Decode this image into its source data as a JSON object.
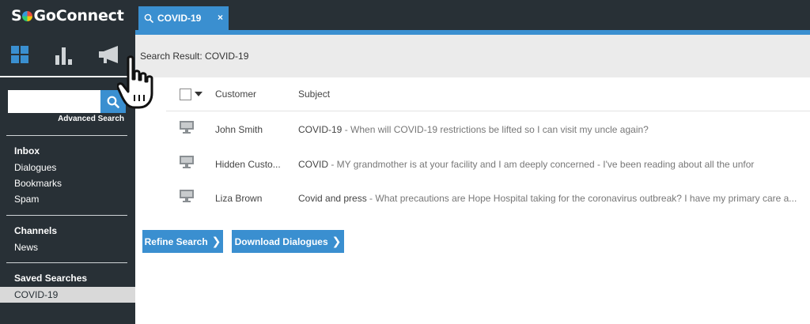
{
  "app": {
    "logo_s": "S",
    "logo_rest": "GoConnect"
  },
  "sidebar": {
    "search_placeholder": "",
    "advanced_search": "Advanced Search",
    "sections": [
      {
        "title": "Inbox",
        "items": [
          "Dialogues",
          "Bookmarks",
          "Spam"
        ]
      },
      {
        "title": "Channels",
        "items": [
          "News"
        ]
      },
      {
        "title": "Saved Searches",
        "items": [
          "COVID-19"
        ]
      }
    ]
  },
  "tab": {
    "label": "COVID-19",
    "close": "×"
  },
  "result": {
    "text": "Search Result: COVID-19"
  },
  "table": {
    "headers": {
      "customer": "Customer",
      "subject": "Subject"
    },
    "rows": [
      {
        "customer": "John Smith",
        "subject": "COVID-19",
        "preview": " - When will COVID-19 restrictions be lifted so I can visit my uncle again?"
      },
      {
        "customer": "Hidden Custo...",
        "subject": "COVID",
        "preview": " - MY grandmother is at your facility and I am deeply concerned - I've been reading about all the unfor"
      },
      {
        "customer": "Liza Brown",
        "subject": "Covid and press",
        "preview": " - What precautions are Hope Hospital taking for the coronavirus outbreak? I have my primary care a..."
      }
    ]
  },
  "buttons": {
    "refine": "Refine Search",
    "download": "Download Dialogues",
    "arrow": "❯"
  },
  "colors": {
    "sidebar": "#283036",
    "accent": "#3a8fd0",
    "result_bar": "#ebebeb"
  },
  "icons": [
    "dashboard-icon",
    "bar-chart-icon",
    "megaphone-icon",
    "search-icon",
    "close-icon",
    "monitor-icon",
    "hand-pointer-icon"
  ]
}
